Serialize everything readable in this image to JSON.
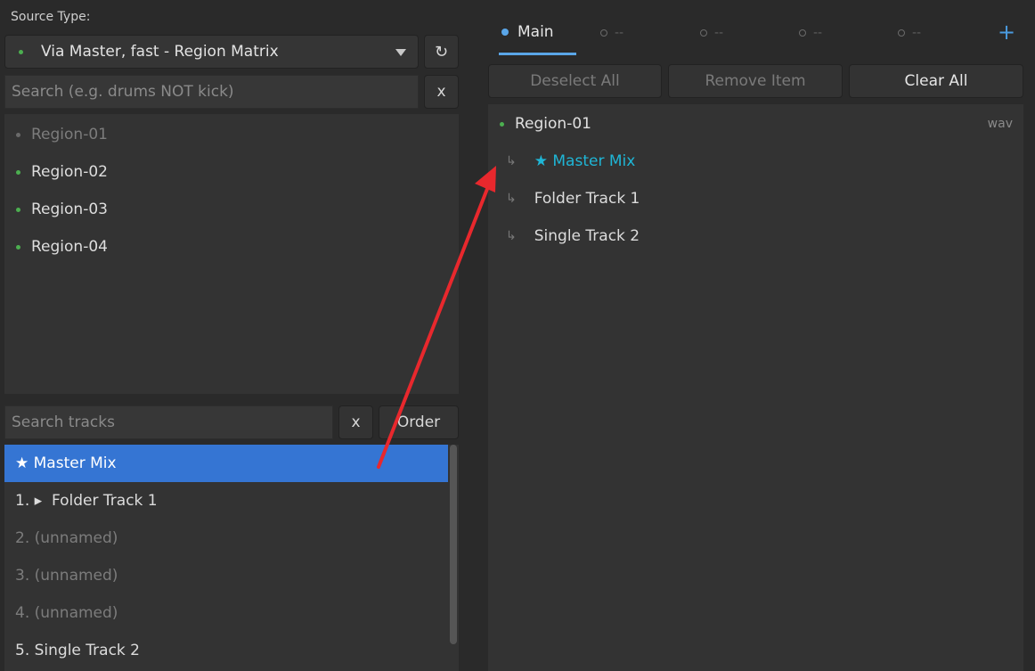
{
  "source": {
    "label": "Source Type:",
    "dropdown_value": "Via Master, fast - Region Matrix",
    "refresh_icon": "refresh-icon",
    "dropdown_icon": "triangle-down-icon"
  },
  "region_search": {
    "placeholder": "Search (e.g. drums NOT kick)",
    "clear_label": "x"
  },
  "regions": [
    {
      "name": "Region-01",
      "dimmed": true
    },
    {
      "name": "Region-02",
      "dimmed": false
    },
    {
      "name": "Region-03",
      "dimmed": false
    },
    {
      "name": "Region-04",
      "dimmed": false
    }
  ],
  "track_search": {
    "placeholder": "Search tracks",
    "clear_label": "x",
    "order_label": "Order"
  },
  "tracks": [
    {
      "label": "★ Master Mix",
      "selected": true
    },
    {
      "label": "1. ▸  Folder Track 1",
      "selected": false
    },
    {
      "label": "2. (unnamed)",
      "selected": false,
      "dimmed": true
    },
    {
      "label": "3. (unnamed)",
      "selected": false,
      "dimmed": true
    },
    {
      "label": "4. (unnamed)",
      "selected": false,
      "dimmed": true
    },
    {
      "label": "5. Single Track 2",
      "selected": false
    }
  ],
  "tabs": {
    "active": "Main",
    "inactive": [
      "--",
      "--",
      "--",
      "--"
    ],
    "add_label": "+"
  },
  "actions": {
    "deselect_all": "Deselect All",
    "remove_item": "Remove Item",
    "clear_all": "Clear All"
  },
  "matrix": {
    "region": "Region-01",
    "format": "wav",
    "child_arrow": "↳",
    "children": [
      {
        "label": "★ Master Mix",
        "highlight": true
      },
      {
        "label": "Folder Track 1",
        "highlight": false
      },
      {
        "label": "Single Track 2",
        "highlight": false
      }
    ]
  },
  "colors": {
    "selection": "#3575d3",
    "accent_cyan": "#1fb6d6",
    "tab_accent": "#5aa6e8",
    "arrow": "#e8282d",
    "dot_green": "#4caf50"
  }
}
